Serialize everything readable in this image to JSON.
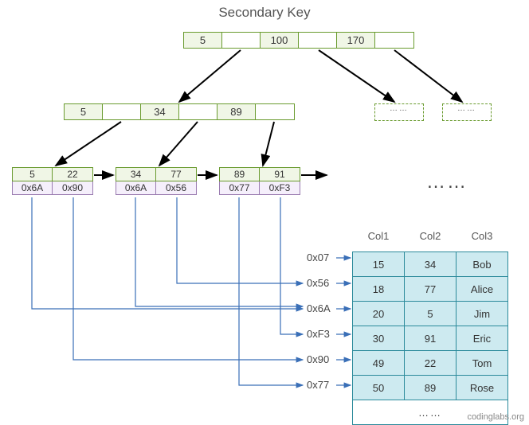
{
  "title": "Secondary Key",
  "root_node": [
    "5",
    "",
    "100",
    "",
    "170",
    ""
  ],
  "internal_node": [
    "5",
    "",
    "34",
    "",
    "89",
    ""
  ],
  "dashed_placeholder": "……",
  "leaves": [
    {
      "keys": [
        "5",
        "22"
      ],
      "ptrs": [
        "0x6A",
        "0x90"
      ]
    },
    {
      "keys": [
        "34",
        "77"
      ],
      "ptrs": [
        "0x6A",
        "0x56"
      ]
    },
    {
      "keys": [
        "89",
        "91"
      ],
      "ptrs": [
        "0x77",
        "0xF3"
      ]
    }
  ],
  "addresses": [
    "0x07",
    "0x56",
    "0x6A",
    "0xF3",
    "0x90",
    "0x77"
  ],
  "leaf_ellipsis": "……",
  "table": {
    "headers": [
      "Col1",
      "Col2",
      "Col3"
    ],
    "rows": [
      [
        "15",
        "34",
        "Bob"
      ],
      [
        "18",
        "77",
        "Alice"
      ],
      [
        "20",
        "5",
        "Jim"
      ],
      [
        "30",
        "91",
        "Eric"
      ],
      [
        "49",
        "22",
        "Tom"
      ],
      [
        "50",
        "89",
        "Rose"
      ]
    ],
    "footer": "……"
  },
  "watermark": "codinglabs.org"
}
